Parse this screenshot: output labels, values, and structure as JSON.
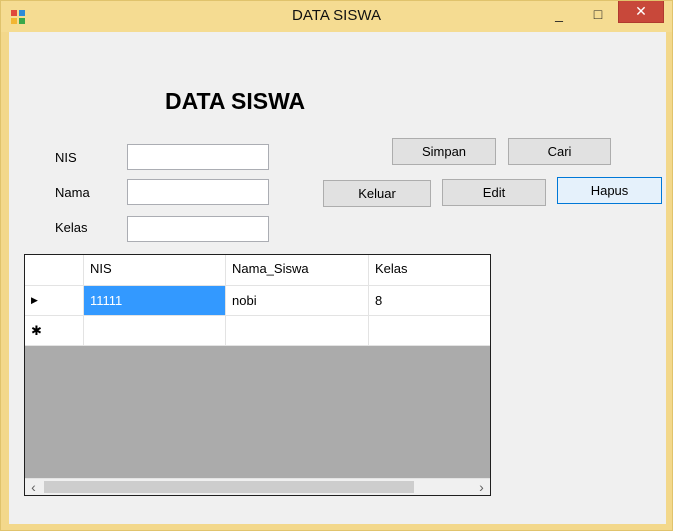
{
  "window": {
    "title": "DATA SISWA",
    "controls": {
      "minimize": "_",
      "maximize": "□",
      "close": "✕"
    },
    "app_icon": "winforms-app-icon"
  },
  "form": {
    "heading": "DATA SISWA",
    "fields": {
      "nis": {
        "label": "NIS",
        "value": ""
      },
      "nama": {
        "label": "Nama",
        "value": ""
      },
      "kelas": {
        "label": "Kelas",
        "value": ""
      }
    },
    "buttons": {
      "simpan": "Simpan",
      "cari": "Cari",
      "keluar": "Keluar",
      "edit": "Edit",
      "hapus": "Hapus"
    }
  },
  "grid": {
    "columns": [
      "NIS",
      "Nama_Siswa",
      "Kelas"
    ],
    "rows": [
      {
        "indicator": "▶",
        "nis": "11111",
        "nama": "nobi",
        "kelas": "8"
      }
    ],
    "new_row_indicator": "✱",
    "scroll": {
      "left": "‹",
      "right": "›"
    }
  },
  "colors": {
    "title_bar": "#f5dc92",
    "close_button": "#c8483a",
    "selection": "#3399ff",
    "grid_background": "#ababab"
  }
}
